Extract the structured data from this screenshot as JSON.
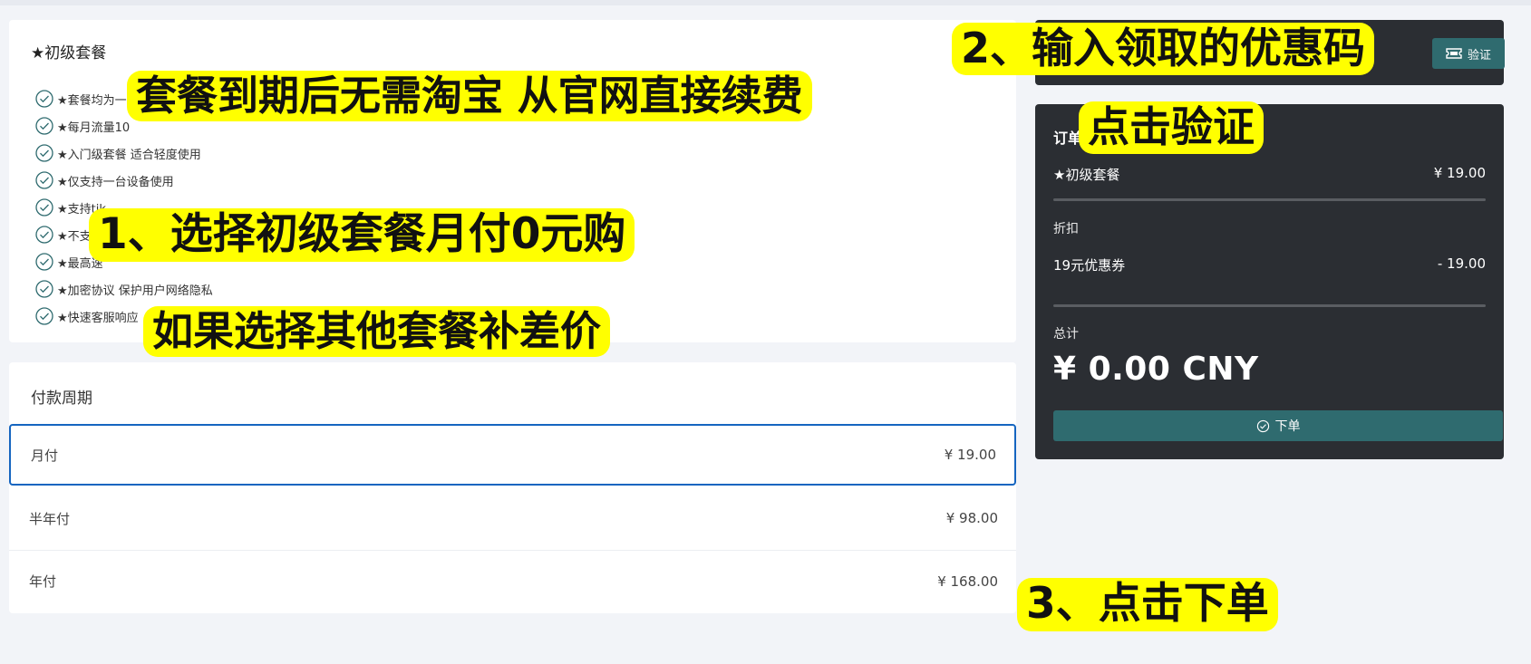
{
  "plan": {
    "title": "★初级套餐",
    "features": [
      "★套餐均为一",
      "★每月流量10",
      "★入门级套餐 适合轻度使用",
      "★仅支持一台设备使用",
      "★支持tik",
      "★不支",
      "★最高速",
      "★加密协议 保护用户网络隐私",
      "★快速客服响应"
    ]
  },
  "billing": {
    "title": "付款周期",
    "selected_index": 0,
    "periods": [
      {
        "label": "月付",
        "price": "¥ 19.00"
      },
      {
        "label": "半年付",
        "price": "¥ 98.00"
      },
      {
        "label": "年付",
        "price": "¥ 168.00"
      }
    ]
  },
  "coupon": {
    "input_value": "",
    "verify_label": "验证",
    "verify_icon": "ticket-icon"
  },
  "order": {
    "title": "订单",
    "item_name": "★初级套餐",
    "item_price": "¥ 19.00",
    "discount_label": "折扣",
    "coupon_name": "19元优惠券",
    "coupon_amount": "- 19.00",
    "total_label": "总计",
    "total_value": "¥ 0.00 CNY",
    "submit_label": "下单",
    "submit_icon": "check-circle-icon"
  },
  "annotations": {
    "renew_note": "套餐到期后无需淘宝 从官网直接续费",
    "step1": "1、选择初级套餐月付0元购",
    "step1_note": "如果选择其他套餐补差价",
    "step2": "2、输入领取的优惠码",
    "step2_sub": "点击验证",
    "step3": "3、点击下单"
  },
  "colors": {
    "page_bg": "#f2f4f8",
    "panel_dark": "#2b2e33",
    "button_teal": "#2f6b6f",
    "selected_border": "#1565c0",
    "annotation_yellow": "#ffff00"
  }
}
